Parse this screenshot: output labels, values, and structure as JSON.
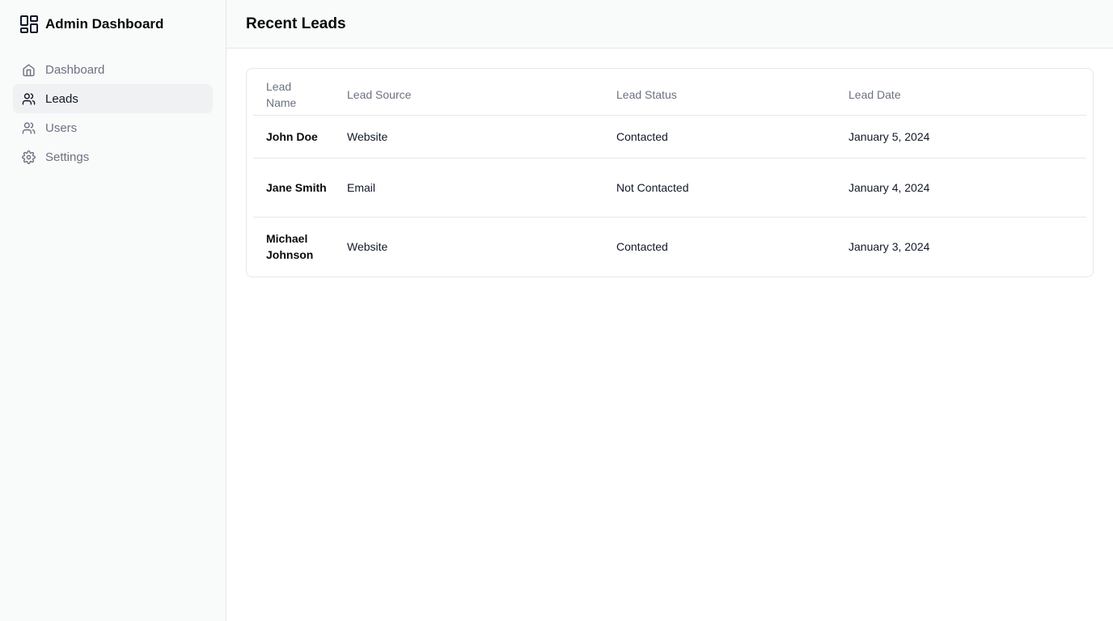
{
  "sidebar": {
    "title": "Admin Dashboard",
    "items": [
      {
        "label": "Dashboard",
        "icon": "home-icon",
        "active": false
      },
      {
        "label": "Leads",
        "icon": "users-icon",
        "active": true
      },
      {
        "label": "Users",
        "icon": "user-icon",
        "active": false
      },
      {
        "label": "Settings",
        "icon": "gear-icon",
        "active": false
      }
    ]
  },
  "header": {
    "title": "Recent Leads"
  },
  "table": {
    "columns": [
      "Lead Name",
      "Lead Source",
      "Lead Status",
      "Lead Date"
    ],
    "rows": [
      {
        "name": "John Doe",
        "source": "Website",
        "status": "Contacted",
        "date": "January 5, 2024"
      },
      {
        "name": "Jane Smith",
        "source": "Email",
        "status": "Not Contacted",
        "date": "January 4, 2024"
      },
      {
        "name": "Michael Johnson",
        "source": "Website",
        "status": "Contacted",
        "date": "January 3, 2024"
      }
    ]
  },
  "colors": {
    "sidebar_bg": "#f9fafa",
    "active_item_bg": "#f0f1f3",
    "muted_text": "#6b7280",
    "border": "#e5e7eb"
  }
}
